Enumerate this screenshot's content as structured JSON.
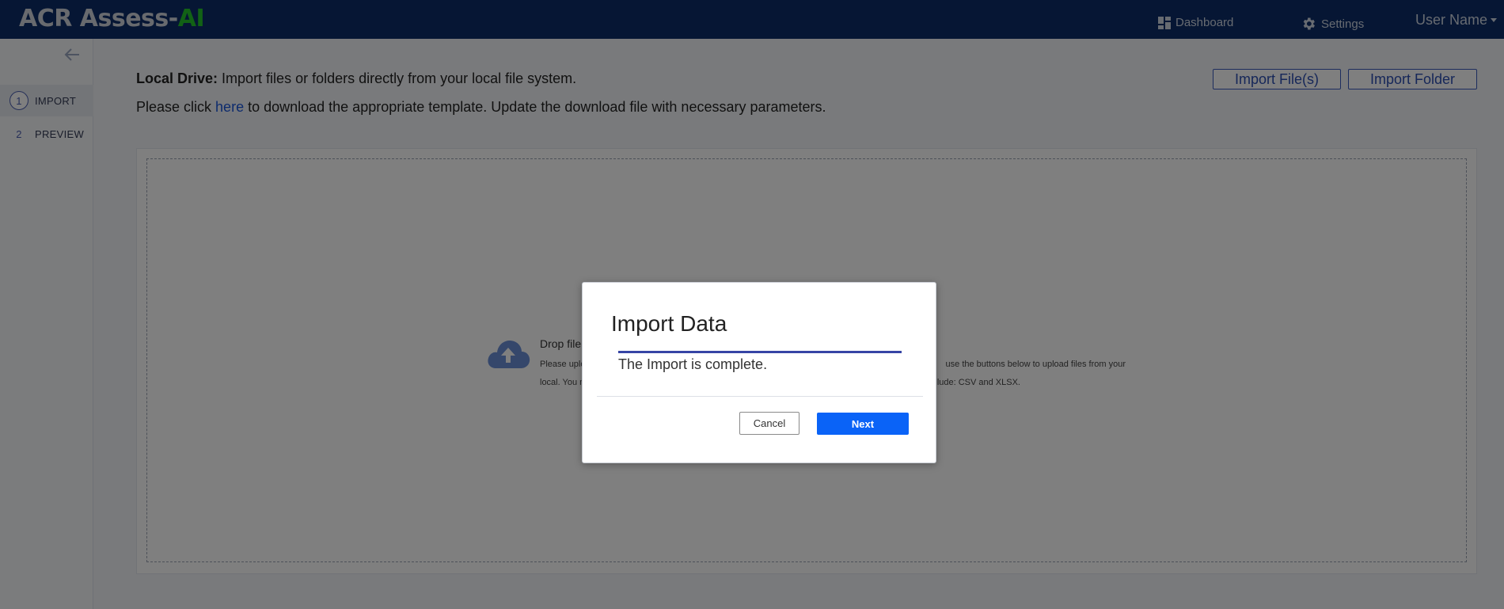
{
  "app": {
    "brand_main": "ACR Assess-",
    "brand_accent": "AI",
    "brand_accent_color": "#25c42a",
    "header_bg": "#0d2d69"
  },
  "header": {
    "dashboard_label": "Dashboard",
    "settings_label": "Settings",
    "user_label": "User Name",
    "dashboard_icon": "dashboard-icon",
    "settings_icon": "gear-icon"
  },
  "sidebar": {
    "back_icon": "arrow-left-icon",
    "steps": [
      {
        "number": "1",
        "label": "IMPORT",
        "active": true
      },
      {
        "number": "2",
        "label": "PREVIEW",
        "active": false
      }
    ]
  },
  "main": {
    "intro_bold": "Local Drive:",
    "intro_text": " Import files or folders directly from your local file system.",
    "template_prefix": "Please click ",
    "template_link": "here",
    "template_suffix": " to download the appropriate template. Update the download file with necessary parameters.",
    "import_files_label": "Import File(s)",
    "import_folder_label": "Import Folder",
    "drop_title": "Drop file",
    "drop_desc_1": "Please uplo",
    "drop_desc_2": "use the buttons below to upload files from your",
    "drop_desc_3": "local. You n",
    "drop_desc_4": "lude: CSV and XLSX.",
    "drop_icon": "cloud-upload-icon"
  },
  "modal": {
    "title": "Import Data",
    "message": "The Import is complete.",
    "progress": 1.0,
    "cancel_label": "Cancel",
    "next_label": "Next",
    "next_color": "#0a63f7"
  }
}
